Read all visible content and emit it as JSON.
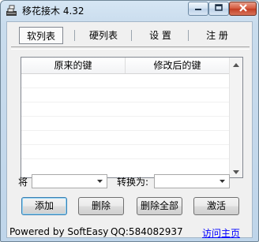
{
  "window": {
    "title": "移花接木 4.32"
  },
  "tabs": [
    {
      "label": "软列表"
    },
    {
      "label": "硬列表"
    },
    {
      "label": "设 置"
    },
    {
      "label": "注 册"
    }
  ],
  "list": {
    "columns": [
      "原来的键",
      "修改后的键"
    ],
    "rows": []
  },
  "form": {
    "source_label": "将",
    "source_value": "",
    "target_label": "转换为:",
    "target_value": ""
  },
  "buttons": {
    "add": "添加",
    "delete": "删除",
    "delete_all": "删除全部",
    "activate": "激活"
  },
  "status": {
    "powered": "Powered by SoftEasy",
    "qq": "QQ:584082937",
    "homepage": "访问主页"
  },
  "colors": {
    "link": "#0000ff",
    "close_button": "#c8452a",
    "title_bar": "#c9dced"
  }
}
